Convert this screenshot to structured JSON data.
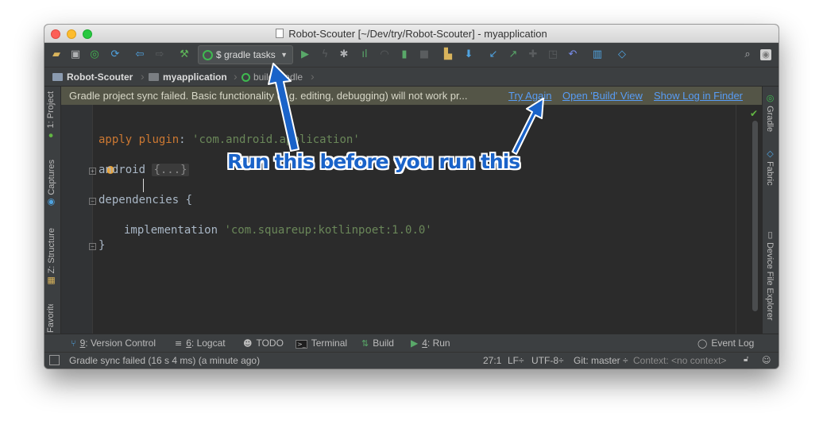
{
  "window": {
    "title": "Robot-Scouter [~/Dev/try/Robot-Scouter] - myapplication"
  },
  "toolbar": {
    "run_config_label": "$ gradle tasks",
    "icons": [
      "open-icon",
      "save-icon",
      "sync-icon",
      "refresh-icon",
      "back-icon",
      "forward-icon",
      "build-hammer-icon",
      "run-icon",
      "apply-changes-icon",
      "debug-icon",
      "profile-icon",
      "attach-icon",
      "stop-icon",
      "avd-manager-icon",
      "sdk-manager-icon",
      "vcs-update-icon",
      "vcs-commit-icon",
      "vcs-compare-icon",
      "vcs-history-icon",
      "revert-icon",
      "project-structure-icon",
      "layers-icon",
      "search-icon",
      "user-icon"
    ]
  },
  "breadcrumb": {
    "items": [
      "Robot-Scouter",
      "myapplication",
      "build.gradle"
    ]
  },
  "notification": {
    "message": "Gradle project sync failed. Basic functionality (e.g. editing, debugging) will not work pr...",
    "links": [
      "Try Again",
      "Open 'Build' View",
      "Show Log in Finder"
    ]
  },
  "left_tabs": [
    "1: Project",
    "Captures",
    "Z: Structure",
    "Favorites"
  ],
  "right_tabs": [
    "Gradle",
    "Fabric",
    "Device File Explorer"
  ],
  "editor": {
    "lines": {
      "l1_kw": "apply",
      "l1_kw2": "plugin",
      "l1_rest": ": ",
      "l1_str": "'com.android.application'",
      "l2_text": "android",
      "l2_fold": "{...}",
      "l3_text": "dependencies {",
      "l4_text": "implementation ",
      "l4_str": "'com.squareup:kotlinpoet:1.0.0'",
      "l5_text": "}"
    }
  },
  "bottom_tools": [
    {
      "key": "9",
      "label": ": Version Control"
    },
    {
      "key": "6",
      "label": ": Logcat"
    },
    {
      "key": "",
      "label": "TODO"
    },
    {
      "key": "",
      "label": "Terminal"
    },
    {
      "key": "",
      "label": "Build"
    },
    {
      "key": "4",
      "label": ": Run"
    }
  ],
  "event_log": "Event Log",
  "status": {
    "message": "Gradle sync failed (16 s 4 ms) (a minute ago)",
    "position": "27:1",
    "line_sep": "LF÷",
    "encoding": "UTF-8÷",
    "git": "Git: master ÷",
    "context": "Context: <no context>"
  },
  "annotation": {
    "text": "Run this before you run this",
    "color": "#1a63c9"
  },
  "colors": {
    "accent_link": "#589df6",
    "keyword": "#cc7832",
    "string": "#6a8759",
    "editor_bg": "#2b2b2b",
    "notification_bg": "#545547",
    "gradle_green": "#3fb950"
  }
}
